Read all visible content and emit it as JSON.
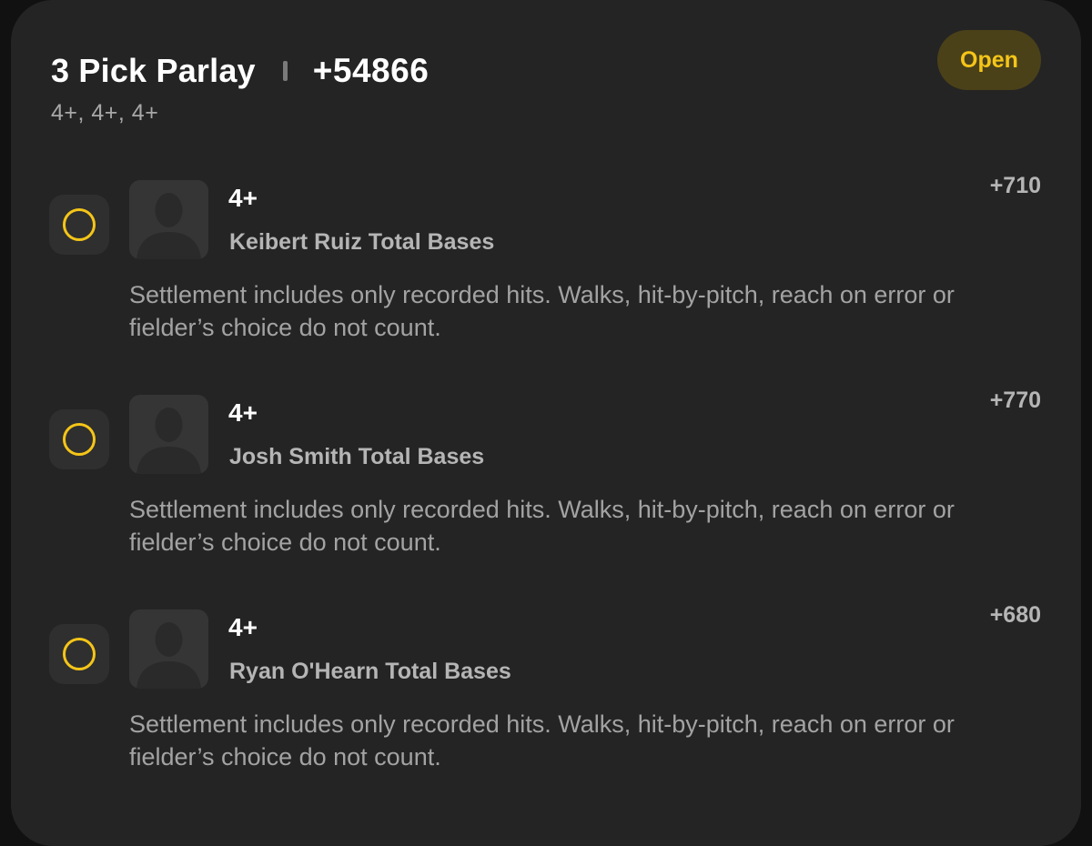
{
  "header": {
    "title": "3 Pick Parlay",
    "total_odds": "+54866",
    "subtitle": "4+, 4+, 4+",
    "status": "Open"
  },
  "colors": {
    "background": "#242424",
    "accent": "#f5c518",
    "badge_bg": "#4a4119"
  },
  "legs": [
    {
      "line": "4+",
      "player": "Keibert Ruiz Total Bases",
      "odds": "+710",
      "description": "Settlement includes only recorded hits. Walks, hit-by-pitch, reach on error or fielder’s choice do not count.",
      "icon": "pending-circle-icon",
      "avatar_icon": "player-silhouette-icon"
    },
    {
      "line": "4+",
      "player": "Josh Smith Total Bases",
      "odds": "+770",
      "description": "Settlement includes only recorded hits. Walks, hit-by-pitch, reach on error or fielder’s choice do not count.",
      "icon": "pending-circle-icon",
      "avatar_icon": "player-silhouette-icon"
    },
    {
      "line": "4+",
      "player": "Ryan O'Hearn Total Bases",
      "odds": "+680",
      "description": "Settlement includes only recorded hits. Walks, hit-by-pitch, reach on error or fielder’s choice do not count.",
      "icon": "pending-circle-icon",
      "avatar_icon": "player-silhouette-icon"
    }
  ]
}
